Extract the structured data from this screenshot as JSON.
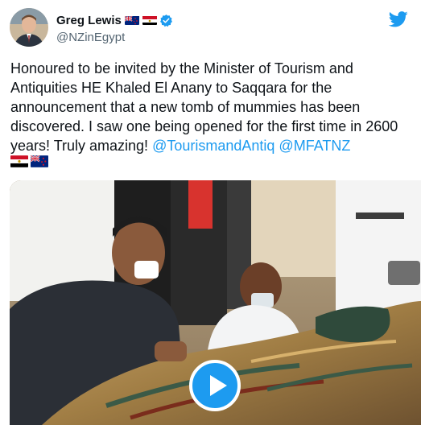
{
  "tweet": {
    "author": {
      "display_name": "Greg Lewis",
      "handle": "@NZinEgypt",
      "flags": [
        "new-zealand-flag",
        "egypt-flag"
      ],
      "verified": true
    },
    "text_parts": {
      "body": "Honoured to be invited by the Minister of Tourism and Antiquities HE Khaled El Anany to Saqqara for the announcement that a new tomb of mummies has been discovered. I saw one being opened for the first time in 2600 years! Truly amazing! ",
      "mention_1": "@TourismandAntiq",
      "space": " ",
      "mention_2": "@MFATNZ"
    },
    "trailing_flags": [
      "egypt-flag",
      "new-zealand-flag"
    ],
    "media": {
      "type": "video",
      "play_icon": "play-icon"
    }
  },
  "colors": {
    "accent": "#1d9bf0",
    "text": "#0f1419",
    "secondary": "#536471"
  }
}
